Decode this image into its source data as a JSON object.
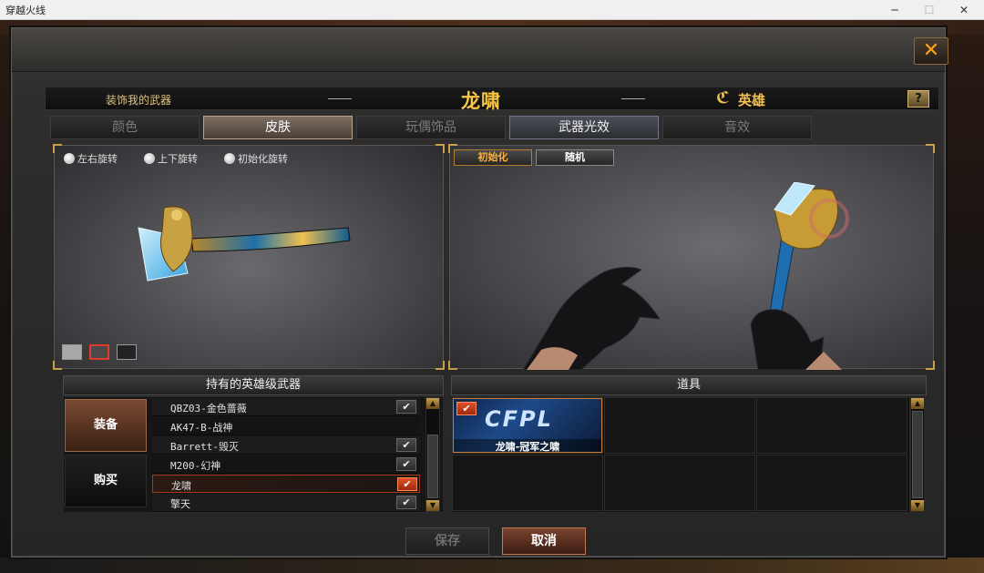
{
  "window": {
    "title": "穿越火线"
  },
  "header": {
    "left_label": "装饰我的武器",
    "weapon_name": "龙啸",
    "hero_label": "英雄",
    "help_label": "?"
  },
  "tabs": [
    {
      "label": "颜色"
    },
    {
      "label": "皮肤"
    },
    {
      "label": "玩偶饰品"
    },
    {
      "label": "武器光效"
    },
    {
      "label": "音效"
    }
  ],
  "left_viewport": {
    "controls": [
      {
        "label": "左右旋转"
      },
      {
        "label": "上下旋转"
      },
      {
        "label": "初始化旋转"
      }
    ]
  },
  "right_viewport": {
    "buttons": [
      {
        "label": "初始化"
      },
      {
        "label": "随机"
      }
    ]
  },
  "weapons_section": {
    "title": "持有的英雄级武器",
    "side_buttons": [
      {
        "label": "装备"
      },
      {
        "label": "购买"
      }
    ],
    "rows": [
      {
        "name": "QBZ03-金色蔷薇",
        "checked": true
      },
      {
        "name": "AK47-B-战神",
        "checked": false
      },
      {
        "name": "Barrett-毁灭",
        "checked": true
      },
      {
        "name": "M200-幻神",
        "checked": true
      },
      {
        "name": "龙啸",
        "checked": true
      },
      {
        "name": "擎天",
        "checked": true
      }
    ]
  },
  "items_section": {
    "title": "道具",
    "items": [
      {
        "name": "龙啸-冠军之啸",
        "logo": "CFPL"
      }
    ]
  },
  "footer": {
    "save_label": "保存",
    "cancel_label": "取消"
  },
  "colors": {
    "accent_gold": "#f7c643",
    "selected_red": "#e0502a",
    "cancel_brown": "#7a4330"
  },
  "icons": {
    "check": "✔",
    "close": "✕",
    "scroll_up": "▲",
    "scroll_down": "▼"
  }
}
